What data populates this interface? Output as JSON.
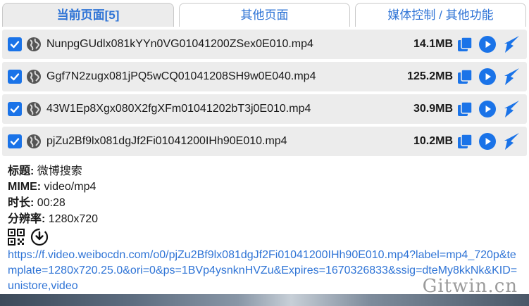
{
  "tabs": [
    {
      "label": "当前页面[5]",
      "active": true
    },
    {
      "label": "其他页面",
      "active": false
    },
    {
      "label": "媒体控制 / 其他功能",
      "active": false
    }
  ],
  "files": [
    {
      "name": "NunpgGUdlx081kYYn0VG01041200ZSex0E010.mp4",
      "size": "14.1MB",
      "checked": true
    },
    {
      "name": "Ggf7N2zugx081jPQ5wCQ01041208SH9w0E040.mp4",
      "size": "125.2MB",
      "checked": true
    },
    {
      "name": "43W1Ep8Xgx080X2fgXFm01041202bT3j0E010.mp4",
      "size": "30.9MB",
      "checked": true
    },
    {
      "name": "pjZu2Bf9lx081dgJf2Fi01041200IHh90E010.mp4",
      "size": "10.2MB",
      "checked": true
    }
  ],
  "details": {
    "title_label": "标题:",
    "title_value": " 微博搜索",
    "mime_label": "MIME:",
    "mime_value": " video/mp4",
    "duration_label": "时长:",
    "duration_value": " 00:28",
    "resolution_label": "分辨率:",
    "resolution_value": " 1280x720",
    "url": "https://f.video.weibocdn.com/o0/pjZu2Bf9lx081dgJf2Fi01041200IHh90E010.mp4?label=mp4_720p&template=1280x720.25.0&ori=0&ps=1BVp4ysnknHVZu&Expires=1670326833&ssig=dteMy8kkNk&KID=unistore,video"
  },
  "watermark": "Gitwin.cn",
  "icons": {
    "checkbox": "checkbox-checked-icon",
    "globe": "globe-icon",
    "copy": "copy-icon",
    "play": "play-icon",
    "download": "download-arrow-icon",
    "qr": "qr-code-icon",
    "download_circle": "download-circle-icon"
  },
  "colors": {
    "accent": "#1a73e8",
    "link": "#2f74d6",
    "row_bg": "#ececec"
  }
}
